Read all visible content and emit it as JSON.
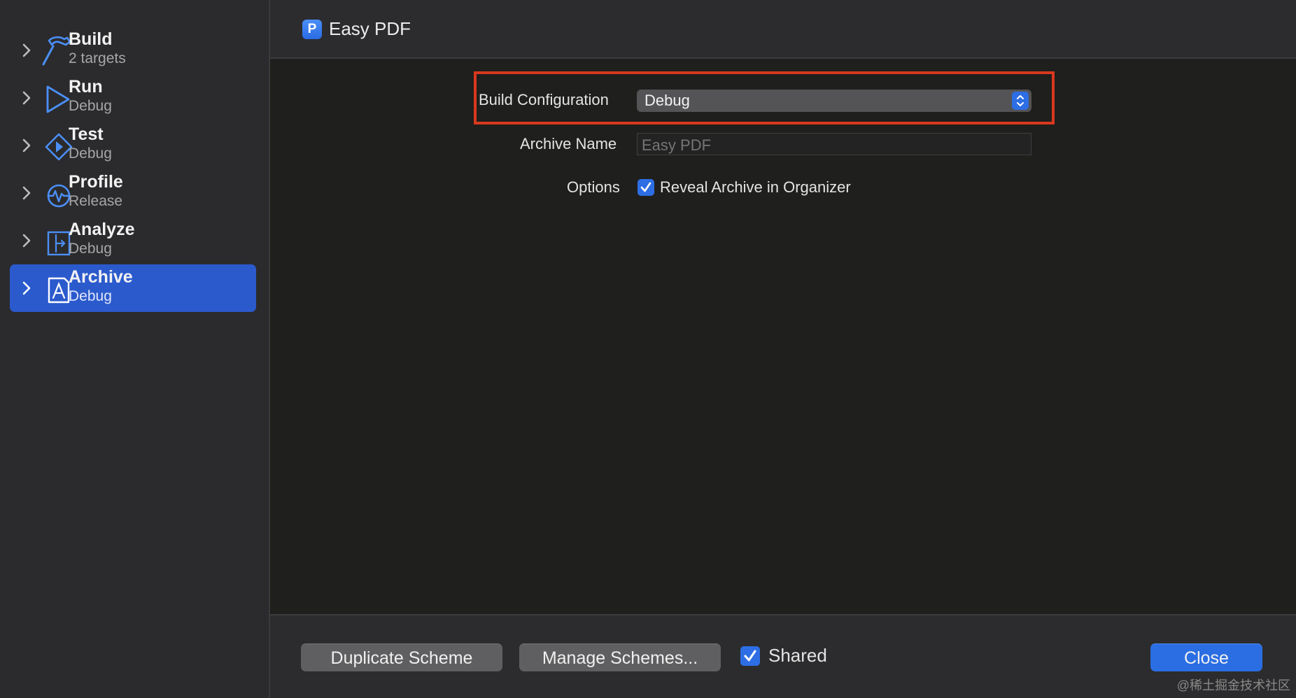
{
  "sidebar": {
    "items": [
      {
        "title": "Build",
        "subtitle": "2 targets",
        "icon": "hammer-icon"
      },
      {
        "title": "Run",
        "subtitle": "Debug",
        "icon": "play-icon"
      },
      {
        "title": "Test",
        "subtitle": "Debug",
        "icon": "test-diamond-icon"
      },
      {
        "title": "Profile",
        "subtitle": "Release",
        "icon": "waveform-icon"
      },
      {
        "title": "Analyze",
        "subtitle": "Debug",
        "icon": "analyze-icon"
      },
      {
        "title": "Archive",
        "subtitle": "Debug",
        "icon": "archive-icon",
        "selected": true
      }
    ]
  },
  "header": {
    "title": "Easy PDF",
    "icon_letter": "P"
  },
  "form": {
    "build_configuration_label": "Build Configuration",
    "build_configuration_value": "Debug",
    "archive_name_label": "Archive Name",
    "archive_name_placeholder": "Easy PDF",
    "options_label": "Options",
    "reveal_archive_label": "Reveal Archive in Organizer",
    "reveal_archive_checked": true
  },
  "footer": {
    "duplicate_label": "Duplicate Scheme",
    "manage_label": "Manage Schemes...",
    "shared_label": "Shared",
    "shared_checked": true,
    "close_label": "Close"
  },
  "watermark": "@稀土掘金技术社区",
  "colors": {
    "accent": "#2b6ee3",
    "selection": "#2b5acd",
    "highlight_border": "#d9381e"
  }
}
